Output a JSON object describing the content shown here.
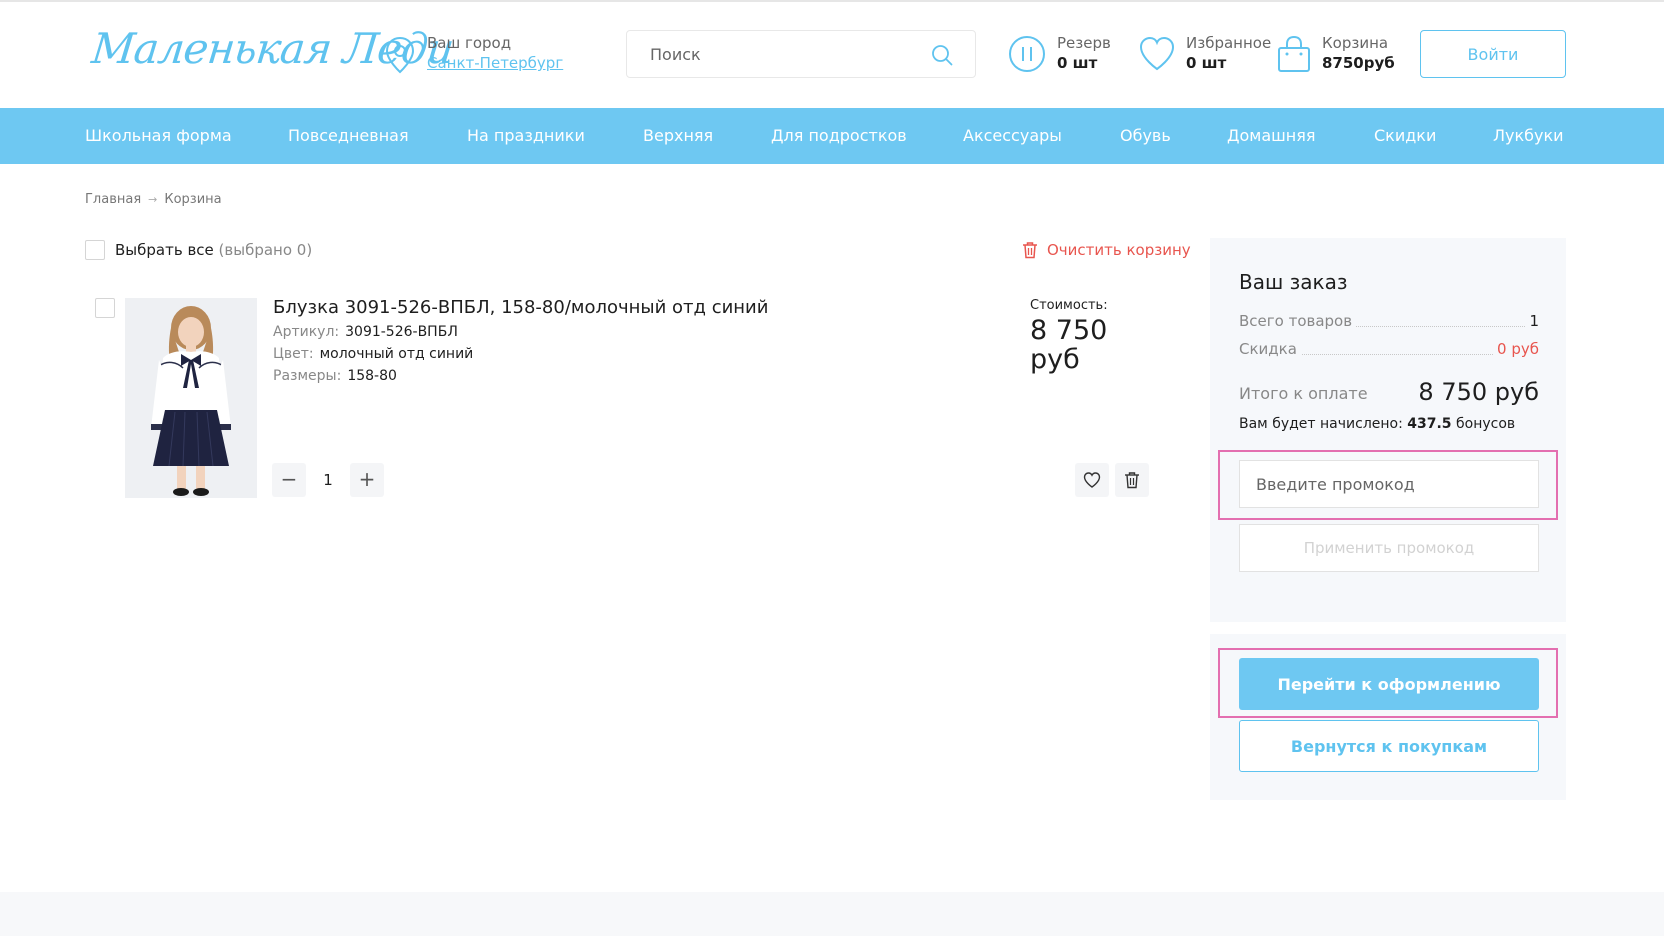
{
  "header": {
    "logo_text": "Маленькая Леди",
    "city_label": "Ваш город",
    "city_value": "Санкт-Петербург",
    "search_placeholder": "Поиск",
    "reserve": {
      "label": "Резерв",
      "value": "0 шт"
    },
    "favorites": {
      "label": "Избранное",
      "value": "0 шт"
    },
    "cart": {
      "label": "Корзина",
      "value": "8750руб"
    },
    "login_label": "Войти"
  },
  "nav": {
    "items": [
      "Школьная форма",
      "Повседневная",
      "На праздники",
      "Верхняя",
      "Для подростков",
      "Аксессуары",
      "Обувь",
      "Домашняя",
      "Скидки",
      "Лукбуки"
    ]
  },
  "breadcrumb": {
    "home": "Главная",
    "separator": "→",
    "current": "Корзина"
  },
  "cart": {
    "select_all_label": "Выбрать все",
    "selected_count": "(выбрано 0)",
    "clear_label": "Очистить корзину",
    "item": {
      "title": "Блузка 3091-526-ВПБЛ, 158-80/молочный отд синий",
      "article_label": "Артикул:",
      "article_value": "3091-526-ВПБЛ",
      "color_label": "Цвет:",
      "color_value": "молочный отд синий",
      "size_label": "Размеры:",
      "size_value": "158-80",
      "cost_label": "Стоимость:",
      "cost_value": "8 750 руб",
      "quantity": "1",
      "minus": "−",
      "plus": "+"
    }
  },
  "order": {
    "title": "Ваш заказ",
    "total_items_label": "Всего товаров",
    "total_items_value": "1",
    "discount_label": "Скидка",
    "discount_value": "0 руб",
    "to_pay_label": "Итого к оплате",
    "to_pay_value": "8 750 руб",
    "bonus_prefix": "Вам будет начислено:",
    "bonus_value": "437.5",
    "bonus_suffix": "бонусов",
    "promo_placeholder": "Введите промокод",
    "apply_promo_label": "Применить промокод",
    "checkout_label": "Перейти к оформлению",
    "back_label": "Вернутся к покупкам"
  },
  "colors": {
    "accent": "#6ec8f2",
    "link": "#5fc3ef",
    "danger": "#e8554e",
    "highlight": "#e36fb0"
  },
  "icons": [
    "location-pin-icon",
    "search-icon",
    "pause-icon",
    "heart-icon",
    "shopping-bag-icon",
    "trash-icon"
  ]
}
